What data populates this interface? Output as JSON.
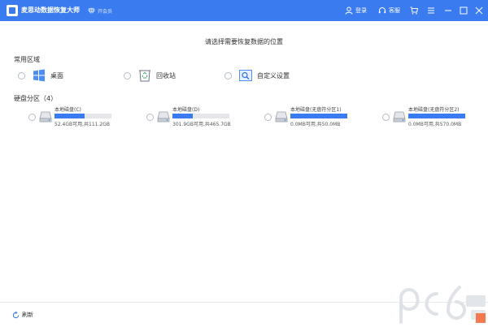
{
  "titlebar": {
    "app_title": "麦思动数据恢复大师",
    "vip_label": "开会员",
    "login_label": "登录",
    "service_label": "客服"
  },
  "main": {
    "prompt": "请选择需要恢复数据的位置",
    "common_title": "常用区域",
    "common_items": [
      {
        "label": "桌面",
        "icon": "windows-desktop-icon"
      },
      {
        "label": "回收站",
        "icon": "recycle-bin-icon"
      },
      {
        "label": "自定义设置",
        "icon": "folder-search-icon"
      }
    ],
    "disk_title": "硬盘分区（4）",
    "disks": [
      {
        "name": "本地磁盘(C)",
        "size": "52.4GB可用,共111.2GB",
        "used_fraction": 0.53
      },
      {
        "name": "本地磁盘(D)",
        "size": "301.9GB可用,共465.7GB",
        "used_fraction": 0.35
      },
      {
        "name": "本地磁盘(无盘符分区1)",
        "size": "0.0MB可用,共50.0MB",
        "used_fraction": 1.0
      },
      {
        "name": "本地磁盘(无盘符分区2)",
        "size": "0.0MB可用,共570.0MB",
        "used_fraction": 1.0
      }
    ]
  },
  "footer": {
    "refresh_label": "刷新"
  },
  "colors": {
    "accent": "#3a7bf0",
    "bar_bg": "#e4e6ea"
  }
}
